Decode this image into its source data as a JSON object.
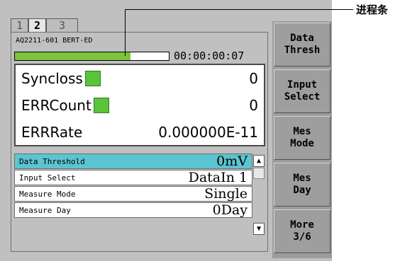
{
  "tabs": [
    {
      "label": "1",
      "active": false
    },
    {
      "label": "2",
      "active": true
    },
    {
      "label": "3",
      "active": false
    }
  ],
  "header": {
    "device_name": "AQ2211-601 BERT-ED",
    "elapsed_time": "00:00:00:07",
    "progress_fraction": 0.75
  },
  "measurements": {
    "syncloss": {
      "label": "Syncloss",
      "value": "0",
      "indicator_color": "#59c33a"
    },
    "errcount": {
      "label": "ERRCount",
      "value": "0",
      "indicator_color": "#59c33a"
    },
    "errrate": {
      "label": "ERRRate",
      "value": "0.000000E-11"
    }
  },
  "settings": [
    {
      "label": "Data Threshold",
      "value": "0mV"
    },
    {
      "label": "Input Select",
      "value": "DataIn 1"
    },
    {
      "label": "Measure Mode",
      "value": "Single"
    },
    {
      "label": "Measure Day",
      "value": "0Day"
    }
  ],
  "softkeys": [
    "Data\nThresh",
    "Input\nSelect",
    "Mes\nMode",
    "Mes\nDay",
    "More\n3/6"
  ],
  "annotation": {
    "label": "进程条"
  },
  "colors": {
    "selected_row": "#5cc4d0",
    "indicator_ok": "#59c33a",
    "progress_fill": "#7dc33e"
  },
  "icons": {
    "scroll_up": "triangle-up-icon",
    "scroll_down": "triangle-down-icon"
  }
}
